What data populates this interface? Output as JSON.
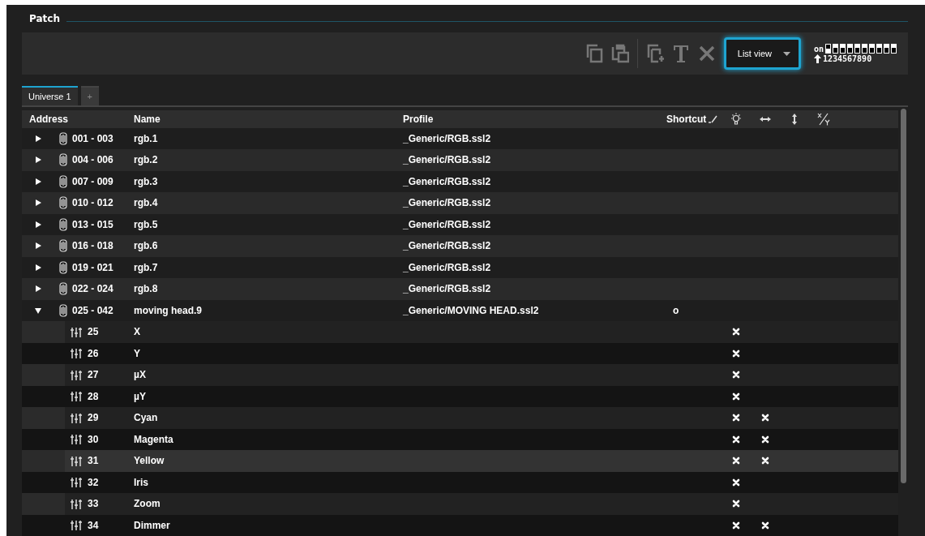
{
  "panel": {
    "title": "Patch"
  },
  "toolbar": {
    "view_select": {
      "value": "List view",
      "focused": true
    },
    "dip_switch": {
      "label": "on",
      "switches": [
        true,
        false,
        false,
        false,
        false,
        false,
        false,
        false,
        false,
        false
      ],
      "numbers": "1234567890"
    }
  },
  "tabs": [
    {
      "label": "Universe 1",
      "selected": true
    },
    {
      "label": "+",
      "selected": false
    }
  ],
  "table": {
    "columns": [
      "Address",
      "Name",
      "Profile",
      "Shortcut"
    ],
    "rows": [
      {
        "expanded": false,
        "address": "001 - 003",
        "name": "rgb.1",
        "profile": "_Generic/RGB.ssl2"
      },
      {
        "expanded": false,
        "address": "004 - 006",
        "name": "rgb.2",
        "profile": "_Generic/RGB.ssl2"
      },
      {
        "expanded": false,
        "address": "007 - 009",
        "name": "rgb.3",
        "profile": "_Generic/RGB.ssl2"
      },
      {
        "expanded": false,
        "address": "010 - 012",
        "name": "rgb.4",
        "profile": "_Generic/RGB.ssl2"
      },
      {
        "expanded": false,
        "address": "013 - 015",
        "name": "rgb.5",
        "profile": "_Generic/RGB.ssl2"
      },
      {
        "expanded": false,
        "address": "016 - 018",
        "name": "rgb.6",
        "profile": "_Generic/RGB.ssl2"
      },
      {
        "expanded": false,
        "address": "019 - 021",
        "name": "rgb.7",
        "profile": "_Generic/RGB.ssl2"
      },
      {
        "expanded": false,
        "address": "022 - 024",
        "name": "rgb.8",
        "profile": "_Generic/RGB.ssl2"
      },
      {
        "expanded": true,
        "address": "025 - 042",
        "name": "moving head.9",
        "profile": "_Generic/MOVING HEAD.ssl2",
        "shortcut": "o",
        "children": [
          {
            "number": "25",
            "name": "X",
            "selected": false,
            "checks": [
              false,
              true,
              false,
              false,
              false
            ]
          },
          {
            "number": "26",
            "name": "Y",
            "selected": false,
            "checks": [
              false,
              true,
              false,
              false,
              false
            ]
          },
          {
            "number": "27",
            "name": "µX",
            "selected": false,
            "checks": [
              false,
              true,
              false,
              false,
              false
            ]
          },
          {
            "number": "28",
            "name": "µY",
            "selected": false,
            "checks": [
              false,
              true,
              false,
              false,
              false
            ]
          },
          {
            "number": "29",
            "name": "Cyan",
            "selected": false,
            "checks": [
              false,
              true,
              true,
              false,
              false
            ]
          },
          {
            "number": "30",
            "name": "Magenta",
            "selected": false,
            "checks": [
              false,
              true,
              true,
              false,
              false
            ]
          },
          {
            "number": "31",
            "name": "Yellow",
            "selected": true,
            "checks": [
              false,
              true,
              true,
              false,
              false
            ]
          },
          {
            "number": "32",
            "name": "Iris",
            "selected": false,
            "checks": [
              false,
              true,
              false,
              false,
              false
            ]
          },
          {
            "number": "33",
            "name": "Zoom",
            "selected": false,
            "checks": [
              false,
              true,
              false,
              false,
              false
            ]
          },
          {
            "number": "34",
            "name": "Dimmer",
            "selected": false,
            "checks": [
              false,
              true,
              true,
              false,
              false
            ]
          }
        ]
      }
    ]
  }
}
